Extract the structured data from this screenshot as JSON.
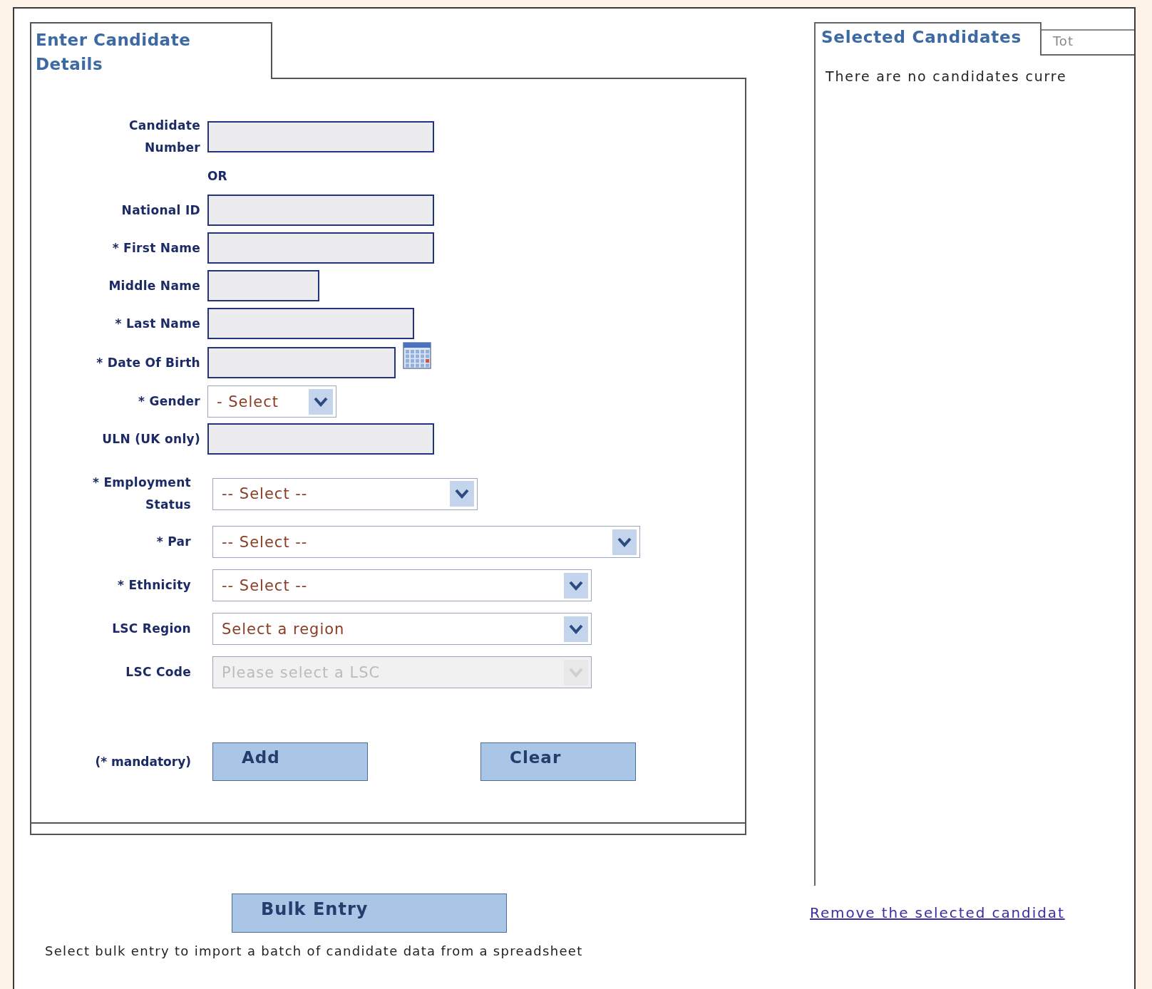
{
  "form": {
    "title": "Enter Candidate Details",
    "fields": [
      {
        "kind": "text",
        "label": "Candidate Number"
      },
      {
        "kind": "separator",
        "label": "OR"
      },
      {
        "kind": "text",
        "label": "National ID"
      },
      {
        "kind": "text",
        "label": "* First Name"
      },
      {
        "kind": "text",
        "label": "Middle Name"
      },
      {
        "kind": "text",
        "label": "* Last Name"
      },
      {
        "kind": "date",
        "label": "* Date Of Birth"
      },
      {
        "kind": "select",
        "label": "* Gender",
        "value": "- Select",
        "disabled": false
      },
      {
        "kind": "text",
        "label": "ULN (UK only)"
      },
      {
        "kind": "select",
        "label": "* Employment Status",
        "value": "-- Select --",
        "disabled": false
      },
      {
        "kind": "select",
        "label": "* Par",
        "value": "-- Select --",
        "disabled": false
      },
      {
        "kind": "select",
        "label": "* Ethnicity",
        "value": "-- Select --",
        "disabled": false
      },
      {
        "kind": "select",
        "label": "LSC Region",
        "value": "Select a region",
        "disabled": false
      },
      {
        "kind": "select",
        "label": "LSC Code",
        "value": "Please select a LSC",
        "disabled": true
      }
    ],
    "note": "(* mandatory)",
    "buttons": [
      "Add",
      "Clear"
    ]
  },
  "bulk": {
    "button": "Bulk Entry",
    "description": "Select bulk entry to import a batch of candidate data from a spreadsheet"
  },
  "selected_panel": {
    "tabs": [
      {
        "label": "Selected Candidates",
        "selected": true
      },
      {
        "label": "Tot",
        "selected": false
      }
    ],
    "message": "There are no candidates curre",
    "link": "Remove the selected candidat"
  }
}
